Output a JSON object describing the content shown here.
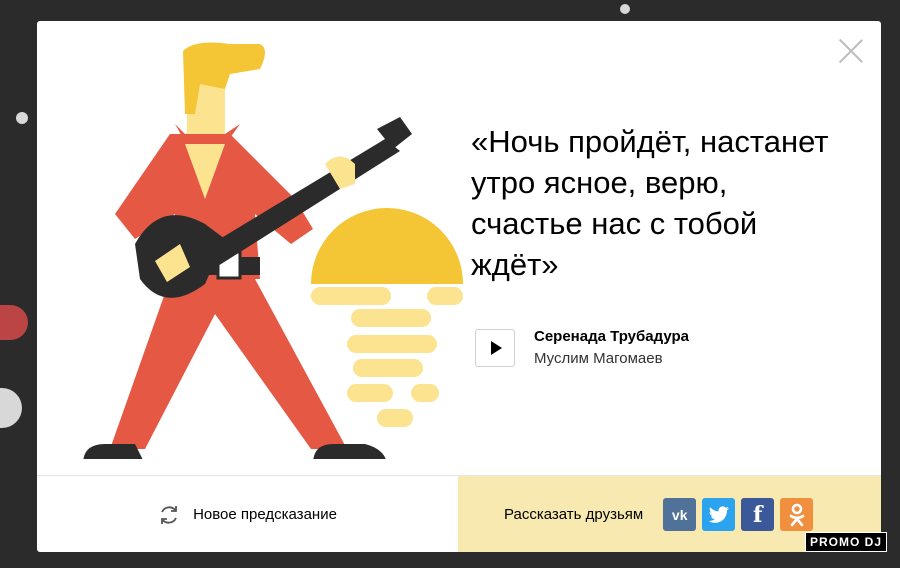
{
  "quote": {
    "lines": [
      "«Ночь пройдёт, настанет",
      "утро ясное, верю,",
      "счастье нас с тобой",
      "ждёт»"
    ]
  },
  "track": {
    "title": "Серенада Трубадура",
    "artist": "Муслим Магомаев"
  },
  "footer": {
    "new_prediction_label": "Новое предсказание",
    "share_label": "Рассказать друзьям"
  },
  "social": [
    "vk-icon",
    "twitter-icon",
    "facebook-icon",
    "odnoklassniki-icon"
  ],
  "watermark": "PROMO DJ",
  "colors": {
    "accent_red": "#e55843",
    "accent_yellow": "#f4c534",
    "share_bg": "#f8e9b0",
    "vk": "#507299",
    "twitter": "#2ba3ef",
    "facebook": "#3b5998",
    "ok": "#f0903f"
  }
}
